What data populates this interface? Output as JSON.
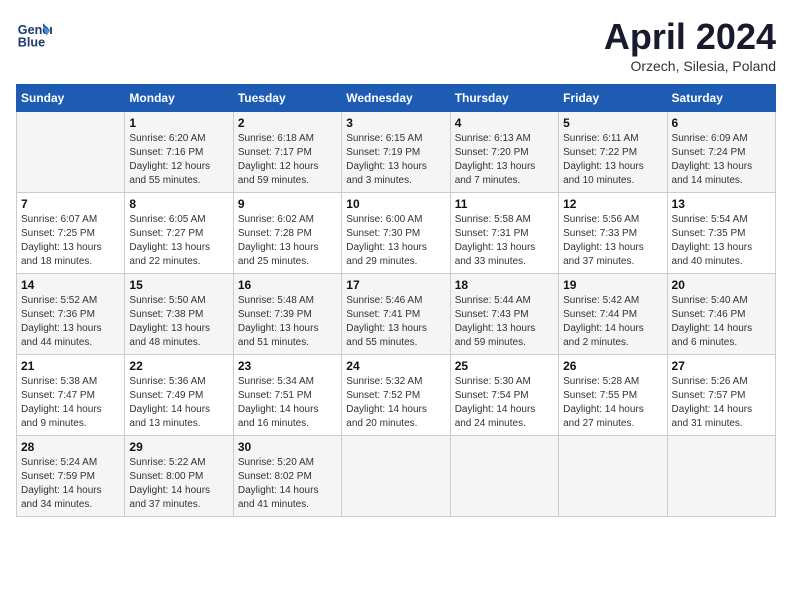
{
  "header": {
    "logo_line1": "General",
    "logo_line2": "Blue",
    "title": "April 2024",
    "subtitle": "Orzech, Silesia, Poland"
  },
  "days_of_week": [
    "Sunday",
    "Monday",
    "Tuesday",
    "Wednesday",
    "Thursday",
    "Friday",
    "Saturday"
  ],
  "weeks": [
    [
      {
        "day": "",
        "detail": ""
      },
      {
        "day": "1",
        "detail": "Sunrise: 6:20 AM\nSunset: 7:16 PM\nDaylight: 12 hours\nand 55 minutes."
      },
      {
        "day": "2",
        "detail": "Sunrise: 6:18 AM\nSunset: 7:17 PM\nDaylight: 12 hours\nand 59 minutes."
      },
      {
        "day": "3",
        "detail": "Sunrise: 6:15 AM\nSunset: 7:19 PM\nDaylight: 13 hours\nand 3 minutes."
      },
      {
        "day": "4",
        "detail": "Sunrise: 6:13 AM\nSunset: 7:20 PM\nDaylight: 13 hours\nand 7 minutes."
      },
      {
        "day": "5",
        "detail": "Sunrise: 6:11 AM\nSunset: 7:22 PM\nDaylight: 13 hours\nand 10 minutes."
      },
      {
        "day": "6",
        "detail": "Sunrise: 6:09 AM\nSunset: 7:24 PM\nDaylight: 13 hours\nand 14 minutes."
      }
    ],
    [
      {
        "day": "7",
        "detail": "Sunrise: 6:07 AM\nSunset: 7:25 PM\nDaylight: 13 hours\nand 18 minutes."
      },
      {
        "day": "8",
        "detail": "Sunrise: 6:05 AM\nSunset: 7:27 PM\nDaylight: 13 hours\nand 22 minutes."
      },
      {
        "day": "9",
        "detail": "Sunrise: 6:02 AM\nSunset: 7:28 PM\nDaylight: 13 hours\nand 25 minutes."
      },
      {
        "day": "10",
        "detail": "Sunrise: 6:00 AM\nSunset: 7:30 PM\nDaylight: 13 hours\nand 29 minutes."
      },
      {
        "day": "11",
        "detail": "Sunrise: 5:58 AM\nSunset: 7:31 PM\nDaylight: 13 hours\nand 33 minutes."
      },
      {
        "day": "12",
        "detail": "Sunrise: 5:56 AM\nSunset: 7:33 PM\nDaylight: 13 hours\nand 37 minutes."
      },
      {
        "day": "13",
        "detail": "Sunrise: 5:54 AM\nSunset: 7:35 PM\nDaylight: 13 hours\nand 40 minutes."
      }
    ],
    [
      {
        "day": "14",
        "detail": "Sunrise: 5:52 AM\nSunset: 7:36 PM\nDaylight: 13 hours\nand 44 minutes."
      },
      {
        "day": "15",
        "detail": "Sunrise: 5:50 AM\nSunset: 7:38 PM\nDaylight: 13 hours\nand 48 minutes."
      },
      {
        "day": "16",
        "detail": "Sunrise: 5:48 AM\nSunset: 7:39 PM\nDaylight: 13 hours\nand 51 minutes."
      },
      {
        "day": "17",
        "detail": "Sunrise: 5:46 AM\nSunset: 7:41 PM\nDaylight: 13 hours\nand 55 minutes."
      },
      {
        "day": "18",
        "detail": "Sunrise: 5:44 AM\nSunset: 7:43 PM\nDaylight: 13 hours\nand 59 minutes."
      },
      {
        "day": "19",
        "detail": "Sunrise: 5:42 AM\nSunset: 7:44 PM\nDaylight: 14 hours\nand 2 minutes."
      },
      {
        "day": "20",
        "detail": "Sunrise: 5:40 AM\nSunset: 7:46 PM\nDaylight: 14 hours\nand 6 minutes."
      }
    ],
    [
      {
        "day": "21",
        "detail": "Sunrise: 5:38 AM\nSunset: 7:47 PM\nDaylight: 14 hours\nand 9 minutes."
      },
      {
        "day": "22",
        "detail": "Sunrise: 5:36 AM\nSunset: 7:49 PM\nDaylight: 14 hours\nand 13 minutes."
      },
      {
        "day": "23",
        "detail": "Sunrise: 5:34 AM\nSunset: 7:51 PM\nDaylight: 14 hours\nand 16 minutes."
      },
      {
        "day": "24",
        "detail": "Sunrise: 5:32 AM\nSunset: 7:52 PM\nDaylight: 14 hours\nand 20 minutes."
      },
      {
        "day": "25",
        "detail": "Sunrise: 5:30 AM\nSunset: 7:54 PM\nDaylight: 14 hours\nand 24 minutes."
      },
      {
        "day": "26",
        "detail": "Sunrise: 5:28 AM\nSunset: 7:55 PM\nDaylight: 14 hours\nand 27 minutes."
      },
      {
        "day": "27",
        "detail": "Sunrise: 5:26 AM\nSunset: 7:57 PM\nDaylight: 14 hours\nand 31 minutes."
      }
    ],
    [
      {
        "day": "28",
        "detail": "Sunrise: 5:24 AM\nSunset: 7:59 PM\nDaylight: 14 hours\nand 34 minutes."
      },
      {
        "day": "29",
        "detail": "Sunrise: 5:22 AM\nSunset: 8:00 PM\nDaylight: 14 hours\nand 37 minutes."
      },
      {
        "day": "30",
        "detail": "Sunrise: 5:20 AM\nSunset: 8:02 PM\nDaylight: 14 hours\nand 41 minutes."
      },
      {
        "day": "",
        "detail": ""
      },
      {
        "day": "",
        "detail": ""
      },
      {
        "day": "",
        "detail": ""
      },
      {
        "day": "",
        "detail": ""
      }
    ]
  ]
}
